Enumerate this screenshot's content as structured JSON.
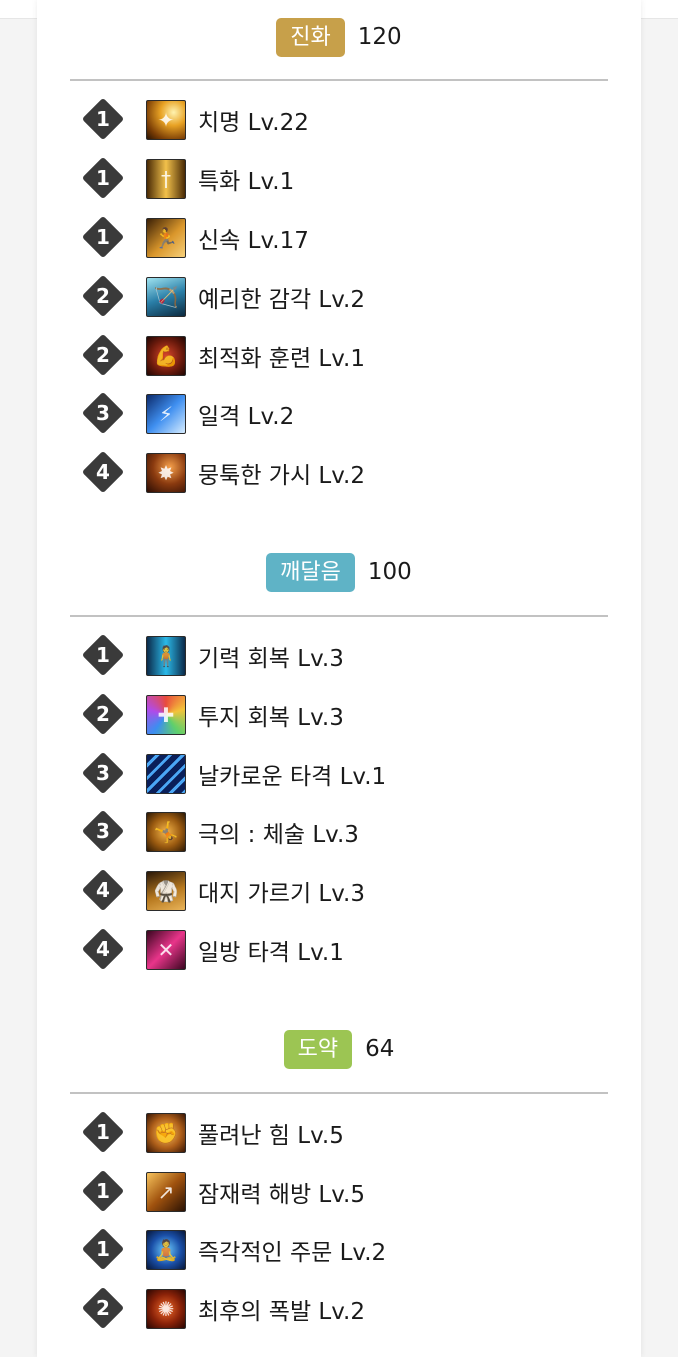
{
  "colors": {
    "evolution_badge": "#c7a04a",
    "enlightenment_badge": "#5fb3c6",
    "leap_badge": "#9cc553"
  },
  "sections": [
    {
      "badge": "진화",
      "count": "120",
      "items": [
        {
          "level": "1",
          "label": "치명 Lv.22",
          "icon": "critical-icon"
        },
        {
          "level": "1",
          "label": "특화 Lv.1",
          "icon": "specialization-icon"
        },
        {
          "level": "1",
          "label": "신속 Lv.17",
          "icon": "swiftness-icon"
        },
        {
          "level": "2",
          "label": "예리한 감각 Lv.2",
          "icon": "keen-senses-icon"
        },
        {
          "level": "2",
          "label": "최적화 훈련 Lv.1",
          "icon": "optimized-training-icon"
        },
        {
          "level": "3",
          "label": "일격 Lv.2",
          "icon": "one-strike-icon"
        },
        {
          "level": "4",
          "label": "뭉툭한 가시 Lv.2",
          "icon": "blunt-thorn-icon"
        }
      ]
    },
    {
      "badge": "깨달음",
      "count": "100",
      "items": [
        {
          "level": "1",
          "label": "기력 회복 Lv.3",
          "icon": "stamina-recovery-icon"
        },
        {
          "level": "2",
          "label": "투지 회복 Lv.3",
          "icon": "fighting-spirit-icon"
        },
        {
          "level": "3",
          "label": "날카로운 타격 Lv.1",
          "icon": "sharp-strike-icon"
        },
        {
          "level": "3",
          "label": "극의 : 체술 Lv.3",
          "icon": "ultimate-martial-icon"
        },
        {
          "level": "4",
          "label": "대지 가르기 Lv.3",
          "icon": "earth-splitter-icon"
        },
        {
          "level": "4",
          "label": "일방 타격 Lv.1",
          "icon": "one-sided-strike-icon"
        }
      ]
    },
    {
      "badge": "도약",
      "count": "64",
      "items": [
        {
          "level": "1",
          "label": "풀려난 힘 Lv.5",
          "icon": "unleashed-power-icon"
        },
        {
          "level": "1",
          "label": "잠재력 해방 Lv.5",
          "icon": "potential-release-icon"
        },
        {
          "level": "1",
          "label": "즉각적인 주문 Lv.2",
          "icon": "instant-spell-icon"
        },
        {
          "level": "2",
          "label": "최후의 폭발 Lv.2",
          "icon": "final-blast-icon"
        }
      ]
    }
  ]
}
